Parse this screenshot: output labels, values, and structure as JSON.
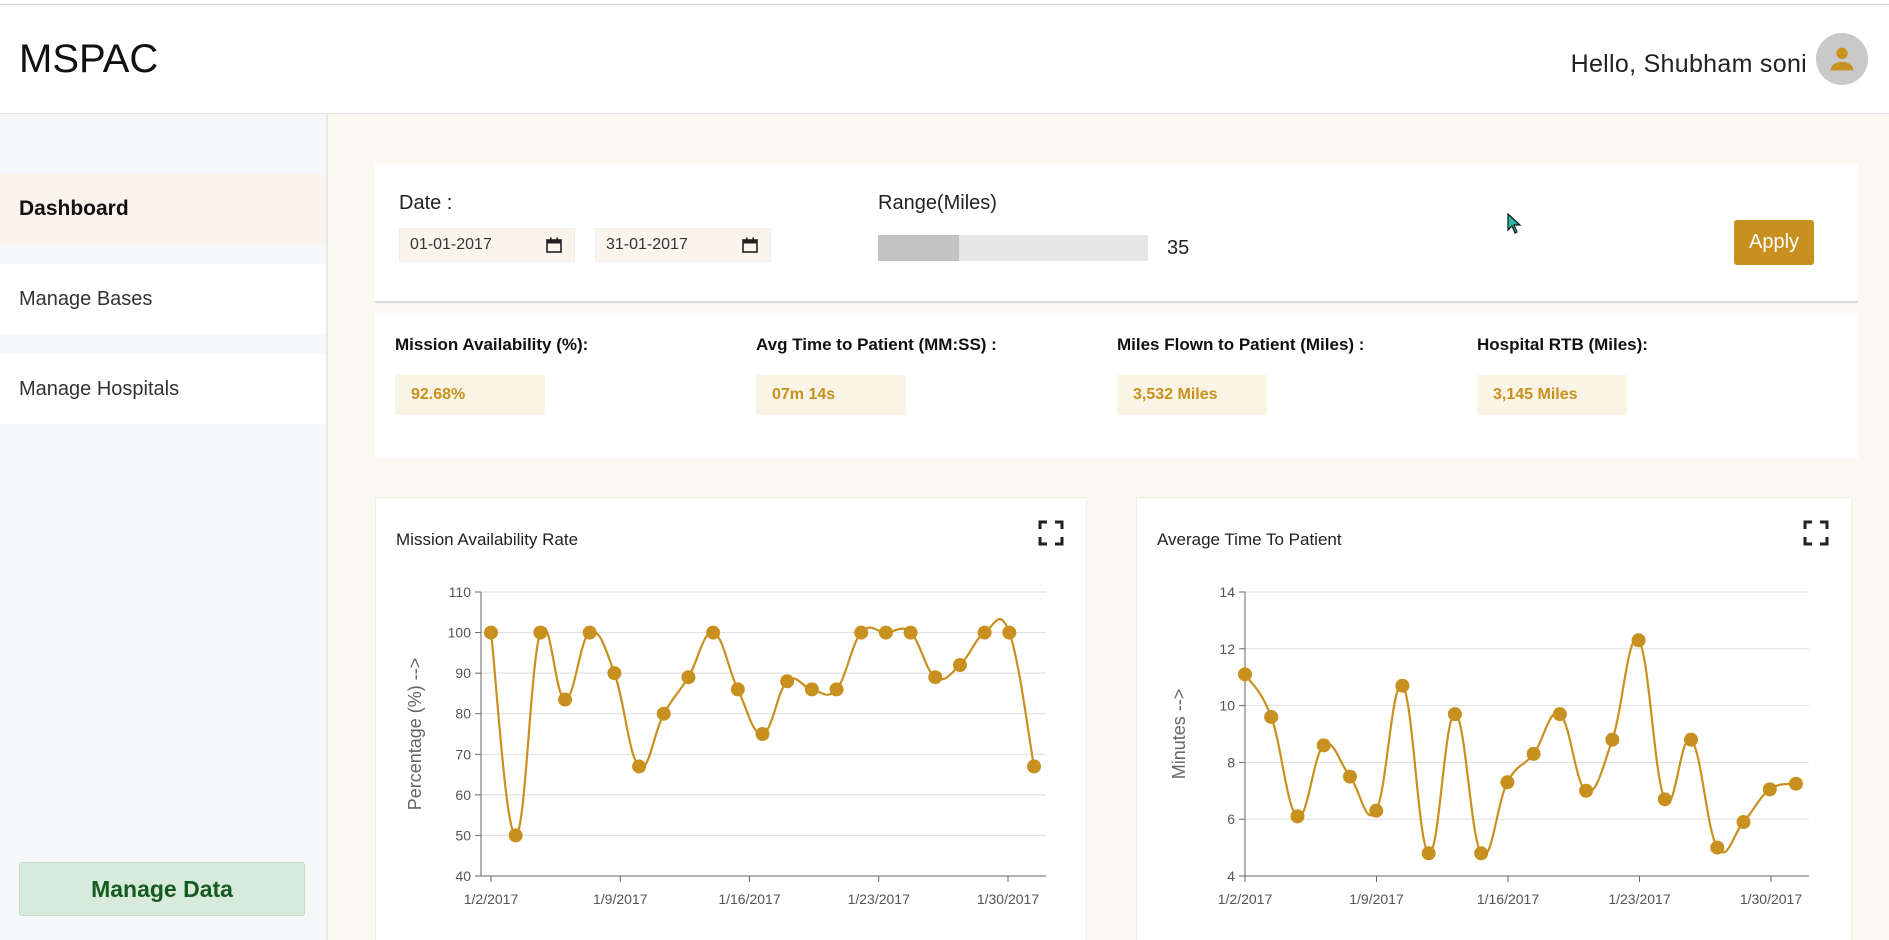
{
  "app": {
    "title": "MSPAC"
  },
  "header": {
    "greeting": "Hello, Shubham soni",
    "avatar_icon": "user-icon"
  },
  "sidebar": {
    "items": [
      {
        "label": "Dashboard",
        "active": true
      },
      {
        "label": "Manage Bases",
        "active": false
      },
      {
        "label": "Manage Hospitals",
        "active": false
      }
    ],
    "manage_data_label": "Manage Data"
  },
  "filters": {
    "date_label": "Date :",
    "date_from": "01-01-2017",
    "date_to": "31-01-2017",
    "range_label": "Range(Miles)",
    "range_value": "35",
    "range_fraction": 0.35,
    "apply_label": "Apply"
  },
  "stats": [
    {
      "label": "Mission Availability (%):",
      "value": "92.68%"
    },
    {
      "label": "Avg Time to Patient (MM:SS) :",
      "value": "07m 14s"
    },
    {
      "label": "Miles Flown to Patient (Miles) :",
      "value": "3,532 Miles"
    },
    {
      "label": "Hospital RTB (Miles):",
      "value": "3,145 Miles"
    }
  ],
  "colors": {
    "accent": "#c8901e",
    "manage_data_bg": "#d7eadb",
    "manage_data_text": "#155a1f"
  },
  "chart_data": [
    {
      "type": "line",
      "title": "Mission Availability Rate",
      "xlabel": "",
      "ylabel": "Percentage (%) -->",
      "ylim": [
        40,
        110
      ],
      "yticks": [
        40,
        50,
        60,
        70,
        80,
        90,
        100,
        110
      ],
      "x_tick_labels": [
        "1/2/2017",
        "1/9/2017",
        "1/16/2017",
        "1/23/2017",
        "1/30/2017"
      ],
      "x_start_label": "1/2/2017",
      "x": [
        "1/2/2017",
        "1/3/2017",
        "1/4/2017",
        "1/5/2017",
        "1/6/2017",
        "1/7/2017",
        "1/8/2017",
        "1/9/2017",
        "1/10/2017",
        "1/11/2017",
        "1/12/2017",
        "1/13/2017",
        "1/14/2017",
        "1/15/2017",
        "1/16/2017",
        "1/17/2017",
        "1/18/2017",
        "1/19/2017",
        "1/20/2017",
        "1/21/2017",
        "1/22/2017",
        "1/23/2017",
        "1/24/2017",
        "1/25/2017",
        "1/26/2017",
        "1/27/2017",
        "1/28/2017",
        "1/29/2017",
        "1/30/2017",
        "1/31/2017",
        "2/1/2017"
      ],
      "values": [
        100,
        50,
        100,
        83.5,
        100,
        90,
        67,
        80,
        89,
        100,
        86,
        75,
        88,
        86,
        86,
        100,
        100,
        100,
        89,
        92,
        100,
        100,
        67
      ],
      "grid": true,
      "color": "#c8901e"
    },
    {
      "type": "line",
      "title": "Average Time To Patient",
      "xlabel": "",
      "ylabel": "Minutes -->",
      "ylim": [
        4,
        14
      ],
      "yticks": [
        4,
        6,
        8,
        10,
        12,
        14
      ],
      "x_tick_labels": [
        "1/2/2017",
        "1/9/2017",
        "1/16/2017",
        "1/23/2017",
        "1/30/2017"
      ],
      "values": [
        11.1,
        9.6,
        6.1,
        8.6,
        7.5,
        6.3,
        10.7,
        4.8,
        9.7,
        4.8,
        7.3,
        8.3,
        9.7,
        7.0,
        8.8,
        12.3,
        6.7,
        8.8,
        5.0,
        5.9,
        7.05,
        7.25
      ],
      "grid": true,
      "color": "#c8901e"
    }
  ]
}
